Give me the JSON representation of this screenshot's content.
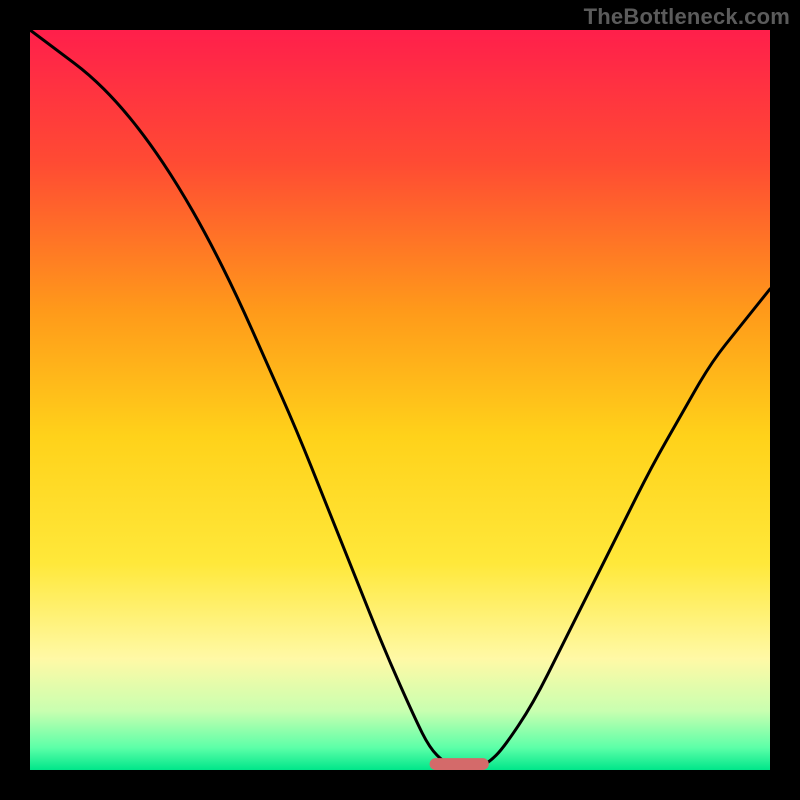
{
  "watermark": "TheBottleneck.com",
  "chart_data": {
    "type": "line",
    "title": "",
    "xlabel": "",
    "ylabel": "",
    "xlim": [
      0,
      100
    ],
    "ylim": [
      0,
      100
    ],
    "grid": false,
    "legend": false,
    "background_gradient": {
      "stops": [
        {
          "offset": 0.0,
          "color": "#ff1f4b"
        },
        {
          "offset": 0.18,
          "color": "#ff4b33"
        },
        {
          "offset": 0.38,
          "color": "#ff9a1a"
        },
        {
          "offset": 0.55,
          "color": "#ffd21a"
        },
        {
          "offset": 0.72,
          "color": "#ffe83a"
        },
        {
          "offset": 0.85,
          "color": "#fff9a6"
        },
        {
          "offset": 0.92,
          "color": "#c9ffb0"
        },
        {
          "offset": 0.97,
          "color": "#5cffa8"
        },
        {
          "offset": 1.0,
          "color": "#00e68a"
        }
      ]
    },
    "series": [
      {
        "name": "bottleneck-curve",
        "color": "#000000",
        "x": [
          0,
          4,
          8,
          12,
          16,
          20,
          24,
          28,
          32,
          36,
          40,
          44,
          48,
          52,
          54,
          56,
          58,
          60,
          62,
          64,
          68,
          72,
          76,
          80,
          84,
          88,
          92,
          96,
          100
        ],
        "y": [
          100,
          97,
          94,
          90,
          85,
          79,
          72,
          64,
          55,
          46,
          36,
          26,
          16,
          7,
          3,
          1,
          0,
          0,
          1,
          3,
          9,
          17,
          25,
          33,
          41,
          48,
          55,
          60,
          65
        ]
      }
    ],
    "markers": [
      {
        "name": "optimum-marker",
        "shape": "rounded-bar",
        "color": "#d46a6a",
        "x_center": 58,
        "y": 0,
        "width": 8,
        "height": 1.6
      }
    ]
  }
}
